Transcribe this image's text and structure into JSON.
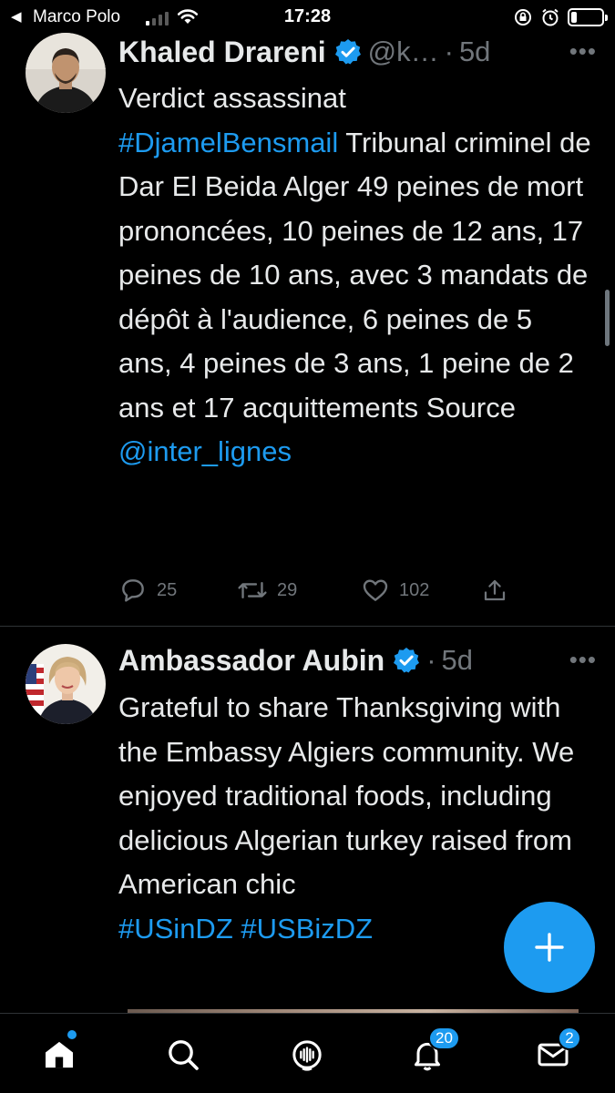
{
  "status_bar": {
    "back_glyph": "◀",
    "carrier": "Marco Polo",
    "time": "17:28",
    "signal_bars": 4,
    "signal_bars_active": 1,
    "battery_level": 0.2,
    "icons": [
      "signal-icon",
      "wifi-icon",
      "rotation-lock-icon",
      "alarm-icon",
      "battery-icon"
    ]
  },
  "tweets": [
    {
      "name": "Khaled Drareni",
      "handle": "@k…",
      "dot": "·",
      "time": "5d",
      "more": "•••",
      "text_1": "Verdict assassinat",
      "hashtag_1": "#DjamelBensmail",
      "text_2": " Tribunal criminel de Dar El Beida Alger 49 peines de mort prononcées, 10 peines de 12 ans, 17 peines de 10 ans, avec 3 mandats de dépôt à l'audience, 6 peines de 5 ans, 4 peines de 3 ans, 1 peine de 2 ans et 17 acquittements Source ",
      "mention_1": "@inter_lignes",
      "replies": "25",
      "retweets": "29",
      "likes": "102"
    },
    {
      "name": "Ambassador Aubin",
      "dot": "·",
      "time": "5d",
      "more": "•••",
      "text_1": "Grateful to share Thanksgiving with the Embassy Algiers community. We enjoyed traditional foods, including delicious Algerian turkey raised from American chic",
      "hashtag_1": "#USinDZ",
      "hashtag_2": "#USBizDZ"
    }
  ],
  "bottom_nav": {
    "notifications_badge": "20",
    "messages_badge": "2"
  },
  "colors": {
    "accent": "#1d9bf0",
    "background": "#000000",
    "text": "#e7e9ea",
    "muted": "#71767b"
  }
}
